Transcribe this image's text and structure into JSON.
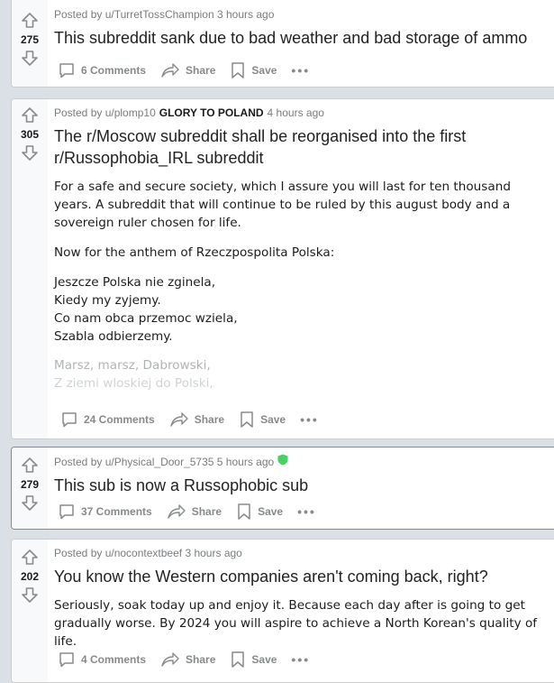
{
  "posts": [
    {
      "votes": "275",
      "posted_by": "Posted by u/TurretTossChampion",
      "time": "3 hours ago",
      "title": "This subreddit sank due to bad weather and bad storage of ammo",
      "comments": "6 Comments",
      "share": "Share",
      "save": "Save",
      "more": "•••"
    },
    {
      "votes": "305",
      "posted_by": "Posted by u/plomp10",
      "flair": "GLORY TO POLAND",
      "time": "4 hours ago",
      "title": "The r/Moscow subreddit shall be reorganised into the first r/Russophobia_IRL subreddit",
      "body": {
        "p1": "For a safe and secure society, which I assure you will last for ten thousand years. A subreddit that will continue to be ruled by this august body and a sovereign ruler chosen for life.",
        "p2": "Now for the anthem of Rzeczpospolita Polska:",
        "verse": [
          "Jeszcze Polska nie zginela,",
          "Kiedy my zyjemy.",
          "Co nam obca przemoc wziela,",
          "Szabla odbierzemy."
        ],
        "faded": [
          "Marsz, marsz, Dabrowski,",
          "Z ziemi wloskiej do Polski,"
        ]
      },
      "comments": "24 Comments",
      "share": "Share",
      "save": "Save",
      "more": "•••"
    },
    {
      "votes": "279",
      "posted_by": "Posted by u/Physical_Door_5735",
      "time": "5 hours ago",
      "title": "This sub is now a Russophobic sub",
      "comments": "37 Comments",
      "share": "Share",
      "save": "Save",
      "more": "•••"
    },
    {
      "votes": "202",
      "posted_by": "Posted by u/nocontextbeef",
      "time": "3 hours ago",
      "title": "You know the Western companies aren't coming back, right?",
      "body": {
        "p1": "Seriously, soak today up and enjoy it. Because each day after is going to get gradually worse. By 2024 you will aspire to achieve a North Korean's quality of life."
      },
      "comments": "4 Comments",
      "share": "Share",
      "save": "Save",
      "more": "•••"
    }
  ],
  "colors": {
    "background": "#dae0e6",
    "vote_bg": "#f8f9fa",
    "meta": "#787c7e",
    "action": "#878a8c",
    "mod_shield": "#46d160"
  },
  "icons": [
    "upvote-icon",
    "downvote-icon",
    "comment-icon",
    "share-icon",
    "save-icon",
    "mod-shield-icon"
  ]
}
